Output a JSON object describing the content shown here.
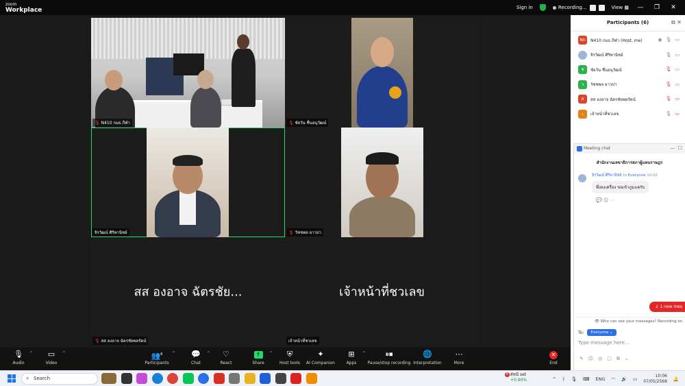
{
  "titlebar": {
    "brand_top": "zoom",
    "brand_bottom": "Workplace",
    "sign_in": "Sign in",
    "recording": "Recording...",
    "view": "View"
  },
  "tiles": [
    {
      "label": "N410 กมธ.กีฬา",
      "muted": false
    },
    {
      "label": "ชัยวัน ชื่นอนุวัฒน์",
      "muted": true
    },
    {
      "label": "จิรวัฒน์ ศิริพานิชย์",
      "muted": false
    },
    {
      "label": "วัชชพล ยาวปา",
      "muted": true
    },
    {
      "label": "สส องอาจ ฉัตรชัยพลรัตน์",
      "muted": true,
      "display_name": "สส องอาจ ฉัตรชัย..."
    },
    {
      "label": "เจ้าหน้าที่ชวเลข",
      "muted": false,
      "display_name": "เจ้าหน้าที่ชวเลข"
    }
  ],
  "toolbar": {
    "audio": "Audio",
    "video": "Video",
    "participants": "Participants",
    "participants_count": "6",
    "chat": "Chat",
    "react": "React",
    "share": "Share",
    "host_tools": "Host tools",
    "ai_companion": "AI Companion",
    "apps": "Apps",
    "pause_recording": "Pause/stop recording",
    "interpretation": "Interpretation",
    "more": "More",
    "end": "End"
  },
  "participants": {
    "title": "Participants (6)",
    "list": [
      {
        "initials": "Nn",
        "name": "N410 กมธ.กีฬา (Host, me)",
        "color": "#d9452b"
      },
      {
        "initials": "",
        "name": "จิรวัฒน์ ศิริพานิชย์",
        "color": "#9cb6d6"
      },
      {
        "initials": "ช",
        "name": "ชัยวัน ชื่นอนุวัฒน์",
        "color": "#2bb24c"
      },
      {
        "initials": "ว",
        "name": "วัชชพล ยาวปา",
        "color": "#2bb24c"
      },
      {
        "initials": "ส",
        "name": "สส องอาจ ฉัตรชัยพลรัตน์",
        "color": "#d9452b"
      },
      {
        "initials": "เ",
        "name": "เจ้าหน้าที่ชวเลข",
        "color": "#e3811a"
      }
    ]
  },
  "chat": {
    "title": "Meeting chat",
    "subtitle": "สำนักงานเลขาธิการสภาผู้แทนราษฎร",
    "sender": "จิรวัฒน์ ศิริพานิชย์",
    "to_word": "to",
    "recipient": "Everyone",
    "time": "10:02",
    "message": "พึ่งลงเครื่อง ขอเข้าภูมแครับ",
    "new_message": "1 new mes",
    "who_can_see": "Who can see your messages? Recording on",
    "to_label": "To:",
    "to_value": "Everyone",
    "placeholder": "Type message here..."
  },
  "taskbar": {
    "search": "Search",
    "weather_badge": "6",
    "weather_title": "ดัชนี set",
    "weather_value": "+0.90%",
    "lang": "ENG",
    "time": "10:06",
    "date": "07/05/2568"
  }
}
